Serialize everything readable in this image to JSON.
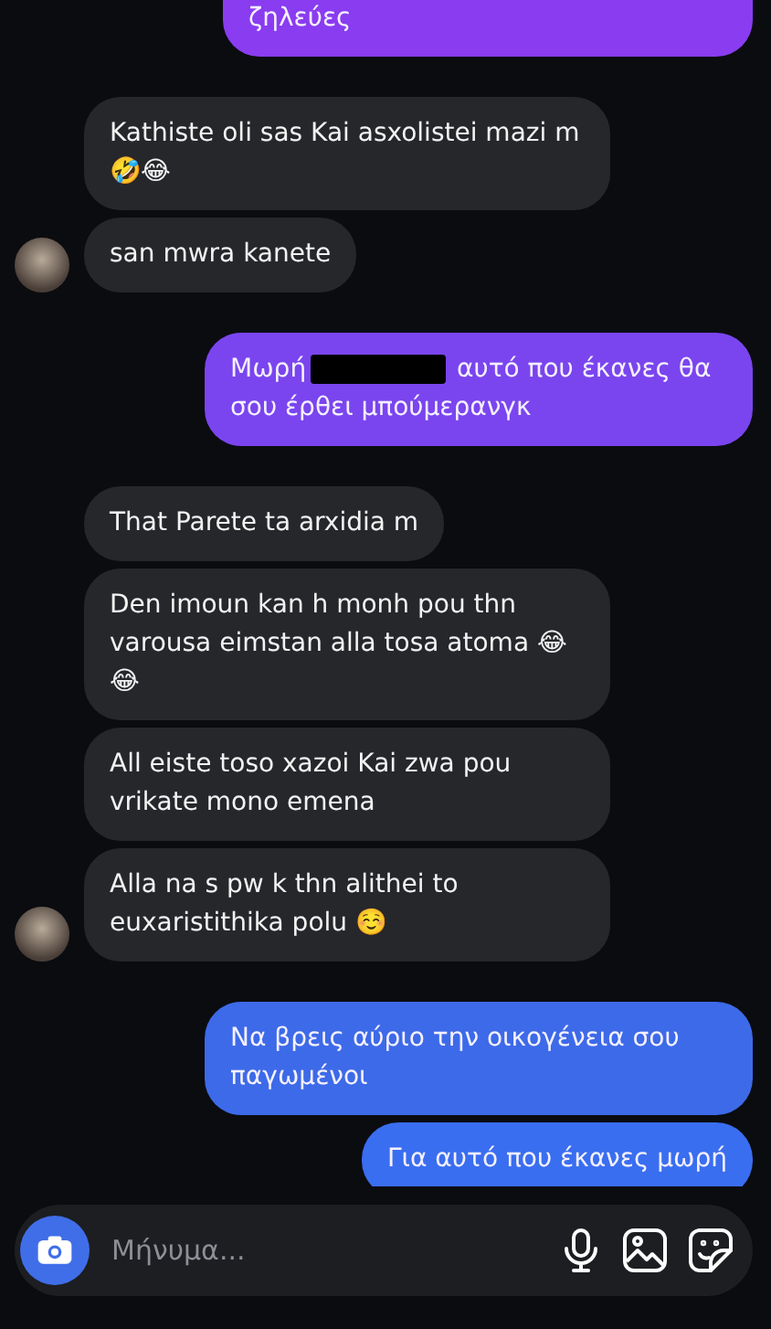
{
  "messages": [
    {
      "kind": "outgoing",
      "text": "ζηλεύες",
      "color": "#8a3cf0",
      "cut_top": true
    },
    {
      "kind": "incoming",
      "text": "Kathiste oli sas Kai asxolistei mazi m 🤣😂",
      "avatar": false
    },
    {
      "kind": "incoming",
      "text": "san mwra kanete",
      "avatar": true
    },
    {
      "kind": "outgoing",
      "text": "Μωρή",
      "redacted": true,
      "text_after": "αυτό που έκανες θα σου έρθει μπούμερανγκ",
      "color": "#7a45ee"
    },
    {
      "kind": "incoming",
      "text": "That Parete ta arxidia m",
      "avatar": false
    },
    {
      "kind": "incoming",
      "text": "Den imoun kan h monh pou thn varousa eimstan alla tosa atoma 😂😂",
      "avatar": false
    },
    {
      "kind": "incoming",
      "text": "All eiste toso xazoi Kai zwa pou vrikate mono emena",
      "avatar": false
    },
    {
      "kind": "incoming",
      "text": "Alla na s pw k thn alithei to euxaristithika polu ☺️",
      "avatar": true
    },
    {
      "kind": "outgoing",
      "text": "Να βρεις αύριο την οικογένεια σου παγωμένοι",
      "color": "#3d6ae8"
    },
    {
      "kind": "outgoing",
      "text": "Για αυτό που έκανες μωρή",
      "color": "#3a6ef0"
    }
  ],
  "composer": {
    "placeholder": "Μήνυμα..."
  }
}
